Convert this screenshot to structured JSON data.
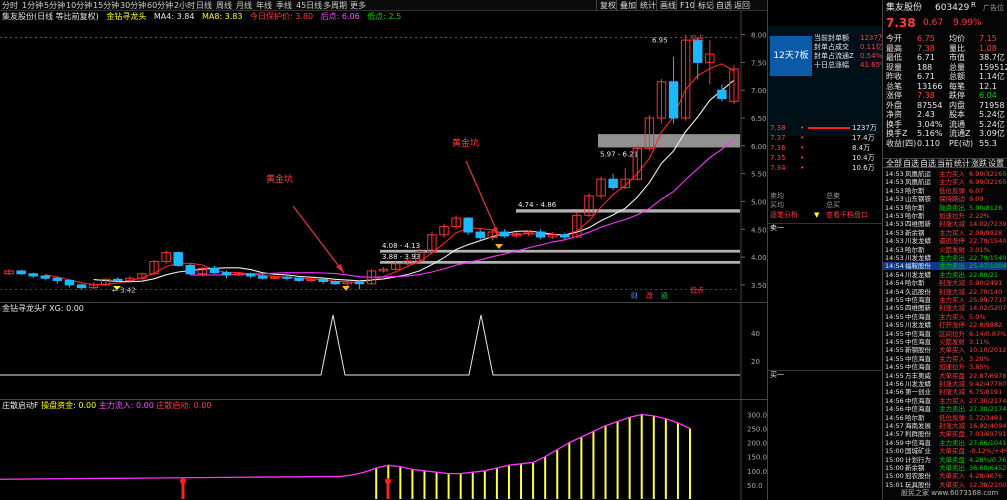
{
  "toolbar": {
    "items": [
      "分时",
      "1分钟",
      "5分钟",
      "10分钟",
      "15分钟",
      "30分钟",
      "60分钟",
      "2小时",
      "日线",
      "周线",
      "月线",
      "年线",
      "季线",
      "45日线",
      "多周期",
      "更多"
    ],
    "right_items": [
      "复权",
      "叠加",
      "统计",
      "画线",
      "F10",
      "标记",
      "自选",
      "返回"
    ]
  },
  "main": {
    "title": "集友股份(日线 等比前复权)",
    "indicator": "金钻寻龙头",
    "ma4_label": "MA4: 3.84",
    "ma8_label": "MA8: 3.83",
    "today_support": "今日保护价: 3.80",
    "high_label": "后点: 6.06",
    "low_label": "低点: 2.5",
    "annotation_1": "黄金坑",
    "annotation_2": "黄金坑",
    "high_marker": "高点",
    "low_marker": "低点",
    "limit_up_label": "12天7板",
    "low_price_tag": "3.42",
    "high_price_tag": "6.95",
    "zone_labels": [
      "5.97 - 6.21",
      "4.74 - 4.86",
      "4.08 - 4.13",
      "3.88 - 3.93"
    ],
    "bottom_tags": [
      "财",
      "改",
      "凯"
    ]
  },
  "axis": {
    "main_ticks": [
      "8.00",
      "7.50",
      "7.00",
      "6.50",
      "6.00",
      "5.50",
      "5.00",
      "4.50",
      "4.00",
      "3.50"
    ],
    "panel2_ticks": [
      "40",
      "20"
    ],
    "panel3_ticks": [
      "300.0",
      "250.0",
      "200.0",
      "150.0",
      "100.0",
      "50.0"
    ]
  },
  "panel2": {
    "title": "金钻寻龙头F",
    "xg_label": "XG: 0.00"
  },
  "panel3": {
    "title": "庄散启动F",
    "pan_label": "操盘资金: 0.00",
    "main_in_label": "主力流入: 0.00",
    "start_label": "庄散启动: 0.00"
  },
  "chart_data": {
    "type": "candlestick",
    "candles": [
      {
        "o": 3.7,
        "c": 3.75,
        "h": 3.78,
        "l": 3.68
      },
      {
        "o": 3.75,
        "c": 3.7,
        "h": 3.77,
        "l": 3.68
      },
      {
        "o": 3.7,
        "c": 3.66,
        "h": 3.72,
        "l": 3.62
      },
      {
        "o": 3.66,
        "c": 3.62,
        "h": 3.68,
        "l": 3.58
      },
      {
        "o": 3.62,
        "c": 3.58,
        "h": 3.65,
        "l": 3.52
      },
      {
        "o": 3.58,
        "c": 3.5,
        "h": 3.6,
        "l": 3.45
      },
      {
        "o": 3.5,
        "c": 3.45,
        "h": 3.52,
        "l": 3.42
      },
      {
        "o": 3.45,
        "c": 3.5,
        "h": 3.55,
        "l": 3.42
      },
      {
        "o": 3.5,
        "c": 3.6,
        "h": 3.62,
        "l": 3.48
      },
      {
        "o": 3.6,
        "c": 3.58,
        "h": 3.64,
        "l": 3.55
      },
      {
        "o": 3.58,
        "c": 3.62,
        "h": 3.66,
        "l": 3.56
      },
      {
        "o": 3.62,
        "c": 3.7,
        "h": 3.72,
        "l": 3.6
      },
      {
        "o": 3.7,
        "c": 3.92,
        "h": 3.95,
        "l": 3.68
      },
      {
        "o": 3.92,
        "c": 4.08,
        "h": 4.12,
        "l": 3.88
      },
      {
        "o": 4.08,
        "c": 3.85,
        "h": 4.1,
        "l": 3.82
      },
      {
        "o": 3.85,
        "c": 3.7,
        "h": 3.88,
        "l": 3.68
      },
      {
        "o": 3.7,
        "c": 3.8,
        "h": 3.82,
        "l": 3.65
      },
      {
        "o": 3.8,
        "c": 3.72,
        "h": 3.84,
        "l": 3.7
      },
      {
        "o": 3.72,
        "c": 3.68,
        "h": 3.76,
        "l": 3.62
      },
      {
        "o": 3.68,
        "c": 3.7,
        "h": 3.73,
        "l": 3.66
      },
      {
        "o": 3.7,
        "c": 3.66,
        "h": 3.72,
        "l": 3.62
      },
      {
        "o": 3.66,
        "c": 3.62,
        "h": 3.69,
        "l": 3.6
      },
      {
        "o": 3.62,
        "c": 3.64,
        "h": 3.66,
        "l": 3.6
      },
      {
        "o": 3.64,
        "c": 3.62,
        "h": 3.66,
        "l": 3.58
      },
      {
        "o": 3.62,
        "c": 3.58,
        "h": 3.64,
        "l": 3.55
      },
      {
        "o": 3.58,
        "c": 3.6,
        "h": 3.62,
        "l": 3.55
      },
      {
        "o": 3.6,
        "c": 3.56,
        "h": 3.62,
        "l": 3.52
      },
      {
        "o": 3.56,
        "c": 3.52,
        "h": 3.58,
        "l": 3.5
      },
      {
        "o": 3.52,
        "c": 3.55,
        "h": 3.58,
        "l": 3.48
      },
      {
        "o": 3.55,
        "c": 3.52,
        "h": 3.58,
        "l": 3.42
      },
      {
        "o": 3.52,
        "c": 3.75,
        "h": 3.78,
        "l": 3.5
      },
      {
        "o": 3.75,
        "c": 3.78,
        "h": 3.82,
        "l": 3.72
      },
      {
        "o": 3.78,
        "c": 3.88,
        "h": 3.92,
        "l": 3.76
      },
      {
        "o": 3.88,
        "c": 3.93,
        "h": 3.98,
        "l": 3.85
      },
      {
        "o": 3.93,
        "c": 4.1,
        "h": 4.15,
        "l": 3.9
      },
      {
        "o": 4.1,
        "c": 4.4,
        "h": 4.45,
        "l": 4.05
      },
      {
        "o": 4.4,
        "c": 4.55,
        "h": 4.6,
        "l": 4.35
      },
      {
        "o": 4.55,
        "c": 4.7,
        "h": 4.75,
        "l": 4.5
      },
      {
        "o": 4.7,
        "c": 4.45,
        "h": 4.72,
        "l": 4.4
      },
      {
        "o": 4.45,
        "c": 4.35,
        "h": 4.5,
        "l": 4.3
      },
      {
        "o": 4.35,
        "c": 4.45,
        "h": 4.48,
        "l": 4.3
      },
      {
        "o": 4.45,
        "c": 4.38,
        "h": 4.5,
        "l": 4.35
      },
      {
        "o": 4.38,
        "c": 4.42,
        "h": 4.45,
        "l": 4.35
      },
      {
        "o": 4.42,
        "c": 4.45,
        "h": 4.48,
        "l": 4.38
      },
      {
        "o": 4.45,
        "c": 4.36,
        "h": 4.5,
        "l": 4.32
      },
      {
        "o": 4.36,
        "c": 4.4,
        "h": 4.45,
        "l": 4.33
      },
      {
        "o": 4.4,
        "c": 4.36,
        "h": 4.44,
        "l": 4.32
      },
      {
        "o": 4.36,
        "c": 4.75,
        "h": 4.8,
        "l": 4.34
      },
      {
        "o": 4.75,
        "c": 5.1,
        "h": 5.15,
        "l": 4.72
      },
      {
        "o": 5.1,
        "c": 5.4,
        "h": 5.45,
        "l": 5.05
      },
      {
        "o": 5.4,
        "c": 5.25,
        "h": 5.5,
        "l": 5.2
      },
      {
        "o": 5.25,
        "c": 5.4,
        "h": 5.6,
        "l": 5.22
      },
      {
        "o": 5.4,
        "c": 5.95,
        "h": 6.0,
        "l": 5.38
      },
      {
        "o": 5.95,
        "c": 6.5,
        "h": 6.55,
        "l": 5.9
      },
      {
        "o": 6.5,
        "c": 7.15,
        "h": 7.2,
        "l": 6.4
      },
      {
        "o": 7.15,
        "c": 6.5,
        "h": 7.6,
        "l": 6.4
      },
      {
        "o": 6.5,
        "c": 7.9,
        "h": 8.0,
        "l": 6.45
      },
      {
        "o": 7.9,
        "c": 7.5,
        "h": 7.95,
        "l": 7.2
      },
      {
        "o": 7.5,
        "c": 7.65,
        "h": 7.9,
        "l": 7.1
      },
      {
        "o": 7.0,
        "c": 6.85,
        "h": 7.1,
        "l": 6.8
      },
      {
        "o": 6.8,
        "c": 7.38,
        "h": 7.45,
        "l": 6.75
      }
    ],
    "ylim": [
      3.3,
      8.1
    ],
    "panel3_ylim": [
      0,
      330
    ],
    "panel3_values": [
      80,
      85,
      95,
      110,
      120,
      115,
      105,
      100,
      95,
      90,
      90,
      95,
      100,
      110,
      120,
      125,
      130,
      150,
      175,
      200,
      220,
      240,
      260,
      275,
      290,
      300,
      295,
      285,
      270,
      250
    ],
    "panel2_peaks": [
      0.45,
      0.65
    ]
  },
  "orderbook": {
    "stock_name": "集友股份",
    "stock_code": "603429",
    "price": "7.38",
    "change": "0.67",
    "pct": "9.99%",
    "tag": "R",
    "ad_label": "广告位",
    "stats": [
      {
        "l": "今开",
        "v": "6.75",
        "l2": "均价",
        "v2": "7.15"
      },
      {
        "l": "最高",
        "v": "7.38",
        "l2": "量比",
        "v2": "1.08"
      },
      {
        "l": "最低",
        "v": "6.71",
        "l2": "市值",
        "v2": "38.7亿"
      },
      {
        "l": "现量",
        "v": "188",
        "l2": "总量",
        "v2": "159512"
      },
      {
        "l": "昨收",
        "v": "6.71",
        "l2": "总额",
        "v2": "1.14亿"
      },
      {
        "l": "总笔",
        "v": "13166",
        "l2": "每笔",
        "v2": "12.1"
      },
      {
        "l": "涨停",
        "v": "7.38",
        "l2": "跌停",
        "v2": "6.04"
      },
      {
        "l": "外盘",
        "v": "87554",
        "l2": "内盘",
        "v2": "71958"
      },
      {
        "l": "净资",
        "v": "2.43",
        "l2": "股本",
        "v2": "5.24亿"
      },
      {
        "l": "换手",
        "v": "3.04%",
        "l2": "流通",
        "v2": "5.24亿"
      },
      {
        "l": "换手Z",
        "v": "5.16%",
        "l2": "流通Z",
        "v2": "3.09亿"
      },
      {
        "l": "收益(四)",
        "v": "0.110",
        "l2": "PE(动)",
        "v2": "55.3"
      }
    ],
    "tabs": [
      "全部",
      "自选",
      "自选",
      "当前",
      "统计",
      "涨跌",
      "设置"
    ],
    "summary": [
      {
        "k": "当前封单额",
        "v": "1237万"
      },
      {
        "k": "封单占成交",
        "v": "0.11亿"
      },
      {
        "k": "封单占流通Z",
        "v": "0.54%"
      },
      {
        "k": "十日总涨幅",
        "v": "41.65%"
      }
    ],
    "limit_rows": [
      {
        "p": "7.38",
        "v": "1237万"
      },
      {
        "p": "7.37",
        "v": "17.4万"
      },
      {
        "p": "7.36",
        "v": "8.4万"
      },
      {
        "p": "7.35",
        "v": "10.4万"
      },
      {
        "p": "7.34",
        "v": "10.6万"
      }
    ],
    "sell_label": "卖均",
    "sell_total": "总卖",
    "buy_label": "买均",
    "buy_total": "总买",
    "analysis": "逐笔分析",
    "view_all": "查看千档盘口",
    "sell_one": "卖一",
    "buy_one": "买一",
    "trades": [
      {
        "t": "14:53",
        "n": "风凰航运",
        "a": "主力买入",
        "v": "6.99/32165"
      },
      {
        "t": "14:53",
        "n": "风凰航运",
        "a": "主力买入",
        "v": "6.99/32165"
      },
      {
        "t": "14:53",
        "n": "哈尔斯",
        "a": "低位反弹",
        "v": "6.07"
      },
      {
        "t": "14:53",
        "n": "山东钢铁",
        "a": "保持路边",
        "v": "9.09"
      },
      {
        "t": "14:53",
        "n": "哈尔斯",
        "a": "融资卖出",
        "v": "5.90/8128"
      },
      {
        "t": "14:53",
        "n": "哈尔斯",
        "a": "加速拉升",
        "v": "2.22%"
      },
      {
        "t": "14:53",
        "n": "四维图新",
        "a": "封涨大减",
        "v": "14.02/7239"
      },
      {
        "t": "14:53",
        "n": "新余钢",
        "a": "主力买入",
        "v": "2.09/9928"
      },
      {
        "t": "14:53",
        "n": "川发龙蟒",
        "a": "逼近涨停",
        "v": "22.79/1540"
      },
      {
        "t": "14:53",
        "n": "哈尔斯",
        "a": "火箭发射",
        "v": "3.01%"
      },
      {
        "t": "14:53",
        "n": "川发龙蟒",
        "a": "主力卖出",
        "v": "22.79/1540"
      },
      {
        "t": "14:54",
        "n": "福鞍股份",
        "a": "主力卖出",
        "v": "25.47/10044"
      },
      {
        "t": "14:54",
        "n": "川发龙蟒",
        "a": "主力卖出",
        "v": "22.80/21"
      },
      {
        "t": "14:54",
        "n": "哈尔斯",
        "a": "封涨大减",
        "v": "5.90/2491"
      },
      {
        "t": "14:54",
        "n": "久远股份",
        "a": "封涨大减",
        "v": "22.70/140"
      },
      {
        "t": "14:55",
        "n": "中信海直",
        "a": "主力买入",
        "v": "25.99/7717"
      },
      {
        "t": "14:55",
        "n": "四维图新",
        "a": "封涨大减",
        "v": "14.02/5207"
      },
      {
        "t": "14:55",
        "n": "中信海直",
        "a": "主力买入",
        "v": "5.0%"
      },
      {
        "t": "14:55",
        "n": "川发龙蟒",
        "a": "打开涨停",
        "v": "22.8/9882"
      },
      {
        "t": "14:55",
        "n": "中信海直",
        "a": "区间拉升",
        "v": "6.14/0.87%"
      },
      {
        "t": "14:55",
        "n": "中信海直",
        "a": "火箭发射",
        "v": "3.11%"
      },
      {
        "t": "14:55",
        "n": "新钢股份",
        "a": "大单买入",
        "v": "10.10/2012"
      },
      {
        "t": "14:55",
        "n": "中信海直",
        "a": "主力买入",
        "v": "3.20%"
      },
      {
        "t": "14:55",
        "n": "中信海直",
        "a": "加速拉升",
        "v": "3.85%"
      },
      {
        "t": "14:55",
        "n": "万丰奥威",
        "a": "大单买盘",
        "v": "22.87/6978"
      },
      {
        "t": "14:56",
        "n": "川发龙蟒",
        "a": "封涨大减",
        "v": "9.42/477809"
      },
      {
        "t": "14:56",
        "n": "第一创业",
        "a": "封涨大减",
        "v": "6.75/8191"
      },
      {
        "t": "14:56",
        "n": "中信海直",
        "a": "主力买入",
        "v": "27.30/21744"
      },
      {
        "t": "14:56",
        "n": "中信海直",
        "a": "主力卖出",
        "v": "27.30/21744"
      },
      {
        "t": "14:56",
        "n": "哈尔斯",
        "a": "低位反弹",
        "v": "5.72/3481"
      },
      {
        "t": "14:57",
        "n": "海南发展",
        "a": "封涨大减",
        "v": "16.92/40941"
      },
      {
        "t": "14:57",
        "n": "利群股份",
        "a": "大单买盘",
        "v": "7.03/69791"
      },
      {
        "t": "14:59",
        "n": "中信海直",
        "a": "主力卖出",
        "v": "27.66/1041"
      },
      {
        "t": "15:00",
        "n": "国城矿业",
        "a": "大单买盘",
        "v": "-0.12%/+4%"
      },
      {
        "t": "15:00",
        "n": "计划行为",
        "a": "大单卖盘",
        "v": "4.28%/0.76"
      },
      {
        "t": "15:00",
        "n": "新余钢",
        "a": "大单卖出",
        "v": "36.60/6452"
      },
      {
        "t": "15:00",
        "n": "冠农股份",
        "a": "大单买入",
        "v": "4.28/4676"
      },
      {
        "t": "15:01",
        "n": "玩具股份",
        "a": "大单买入",
        "v": "12.38/21005"
      }
    ]
  },
  "colors": {
    "up": "#ff3030",
    "down": "#1fb8ff",
    "ma_white": "#eeeeee",
    "ma_magenta": "#ff33ff",
    "ma_red": "#ff2020",
    "panel3_bar": "#ffff40"
  },
  "watermark": "股民之家 www.6073168.com"
}
